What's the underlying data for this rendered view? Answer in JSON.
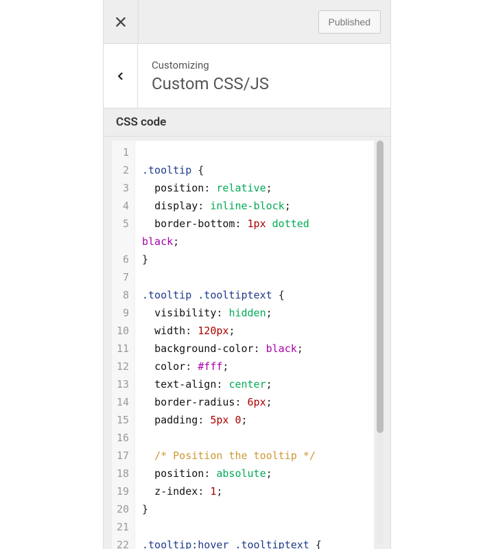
{
  "topbar": {
    "published_label": "Published"
  },
  "header": {
    "crumb": "Customizing",
    "title": "Custom CSS/JS"
  },
  "section": {
    "label": "CSS code"
  },
  "editor": {
    "line_count": 22,
    "css_source": "\n.tooltip {\n  position: relative;\n  display: inline-block;\n  border-bottom: 1px dotted black;\n}\n\n.tooltip .tooltiptext {\n  visibility: hidden;\n  width: 120px;\n  background-color: black;\n  color: #fff;\n  text-align: center;\n  border-radius: 6px;\n  padding: 5px 0;\n\n  /* Position the tooltip */\n  position: absolute;\n  z-index: 1;\n}\n\n.tooltip:hover .tooltiptext {",
    "lines": [
      {
        "n": 1,
        "html": ""
      },
      {
        "n": 2,
        "html": "<span class='sel-first'>.tooltip</span> <span class='punct'>{</span>"
      },
      {
        "n": 3,
        "html": "  <span class='prop'>position</span><span class='punct'>:</span> <span class='val'>relative</span><span class='punct'>;</span>"
      },
      {
        "n": 4,
        "html": "  <span class='prop'>display</span><span class='punct'>:</span> <span class='val'>inline-block</span><span class='punct'>;</span>"
      },
      {
        "n": 5,
        "html": "  <span class='prop'>border-bottom</span><span class='punct'>:</span> <span class='num'>1px</span> <span class='val'>dotted</span>"
      },
      {
        "n": "",
        "html": "<span class='col'>black</span><span class='punct'>;</span>"
      },
      {
        "n": 6,
        "html": "<span class='punct'>}</span>"
      },
      {
        "n": 7,
        "html": ""
      },
      {
        "n": 8,
        "html": "<span class='sel-first'>.tooltip</span> <span class='sel-first'>.tooltiptext</span> <span class='punct'>{</span>"
      },
      {
        "n": 9,
        "html": "  <span class='prop'>visibility</span><span class='punct'>:</span> <span class='val'>hidden</span><span class='punct'>;</span>"
      },
      {
        "n": 10,
        "html": "  <span class='prop'>width</span><span class='punct'>:</span> <span class='num'>120px</span><span class='punct'>;</span>"
      },
      {
        "n": 11,
        "html": "  <span class='prop'>background-color</span><span class='punct'>:</span> <span class='col'>black</span><span class='punct'>;</span>"
      },
      {
        "n": 12,
        "html": "  <span class='prop'>color</span><span class='punct'>:</span> <span class='col'>#fff</span><span class='punct'>;</span>"
      },
      {
        "n": 13,
        "html": "  <span class='prop'>text-align</span><span class='punct'>:</span> <span class='val'>center</span><span class='punct'>;</span>"
      },
      {
        "n": 14,
        "html": "  <span class='prop'>border-radius</span><span class='punct'>:</span> <span class='num'>6px</span><span class='punct'>;</span>"
      },
      {
        "n": 15,
        "html": "  <span class='prop'>padding</span><span class='punct'>:</span> <span class='num'>5px</span> <span class='num'>0</span><span class='punct'>;</span>"
      },
      {
        "n": 16,
        "html": ""
      },
      {
        "n": 17,
        "html": "  <span class='cmt'>/* Position the tooltip */</span>"
      },
      {
        "n": 18,
        "html": "  <span class='prop'>position</span><span class='punct'>:</span> <span class='val'>absolute</span><span class='punct'>;</span>"
      },
      {
        "n": 19,
        "html": "  <span class='prop'>z-index</span><span class='punct'>:</span> <span class='num'>1</span><span class='punct'>;</span>"
      },
      {
        "n": 20,
        "html": "<span class='punct'>}</span>"
      },
      {
        "n": 21,
        "html": ""
      },
      {
        "n": 22,
        "html": "<span class='sel-first'>.tooltip:hover</span> <span class='sel-first'>.tooltiptext</span> <span class='punct'>{</span>"
      }
    ]
  }
}
